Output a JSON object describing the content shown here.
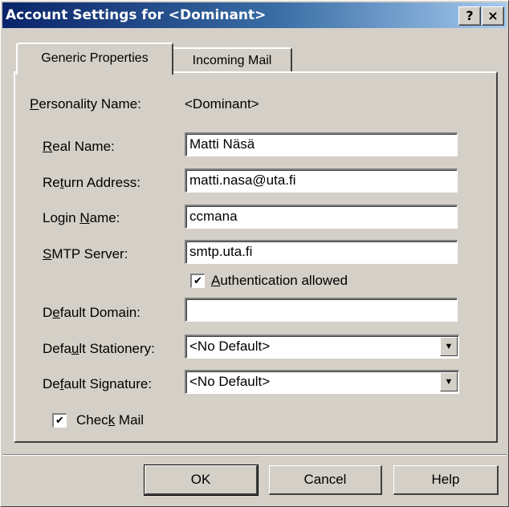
{
  "window": {
    "title_prefix": "Account Settings for ",
    "title_account": "<Dominant>",
    "help_glyph": "?",
    "close_glyph": "×"
  },
  "tabs": [
    {
      "label": "Generic Properties",
      "active": true
    },
    {
      "label": "Incoming Mail",
      "active": false
    }
  ],
  "form": {
    "personality": {
      "label_u": "P",
      "label_rest": "ersonality Name:",
      "value": "<Dominant>"
    },
    "real_name": {
      "label_u": "R",
      "label_rest": "eal Name:",
      "value": "Matti Näsä"
    },
    "return_address": {
      "label_pre": "Re",
      "label_u": "t",
      "label_rest": "urn Address:",
      "value": "matti.nasa@uta.fi"
    },
    "login_name": {
      "label_pre": "Login ",
      "label_u": "N",
      "label_rest": "ame:",
      "value": "ccmana"
    },
    "smtp_server": {
      "label_u": "S",
      "label_rest": "MTP Server:",
      "value": "smtp.uta.fi"
    },
    "auth": {
      "label_u": "A",
      "label_rest": "uthentication allowed",
      "checked": true
    },
    "default_domain": {
      "label_pre": "D",
      "label_u": "e",
      "label_rest": "fault Domain:",
      "value": ""
    },
    "default_stationery": {
      "label_pre": "Defa",
      "label_u": "u",
      "label_rest": "lt Stationery:",
      "value": "<No Default>"
    },
    "default_signature": {
      "label_pre": "De",
      "label_u": "f",
      "label_rest": "ault Signature:",
      "value": "<No Default>"
    },
    "check_mail": {
      "label_pre": "Chec",
      "label_u": "k",
      "label_rest": " Mail",
      "checked": true
    }
  },
  "checkmark": "✔",
  "dropdown_arrow": "▼",
  "buttons": {
    "ok": "OK",
    "cancel": "Cancel",
    "help": "Help"
  }
}
